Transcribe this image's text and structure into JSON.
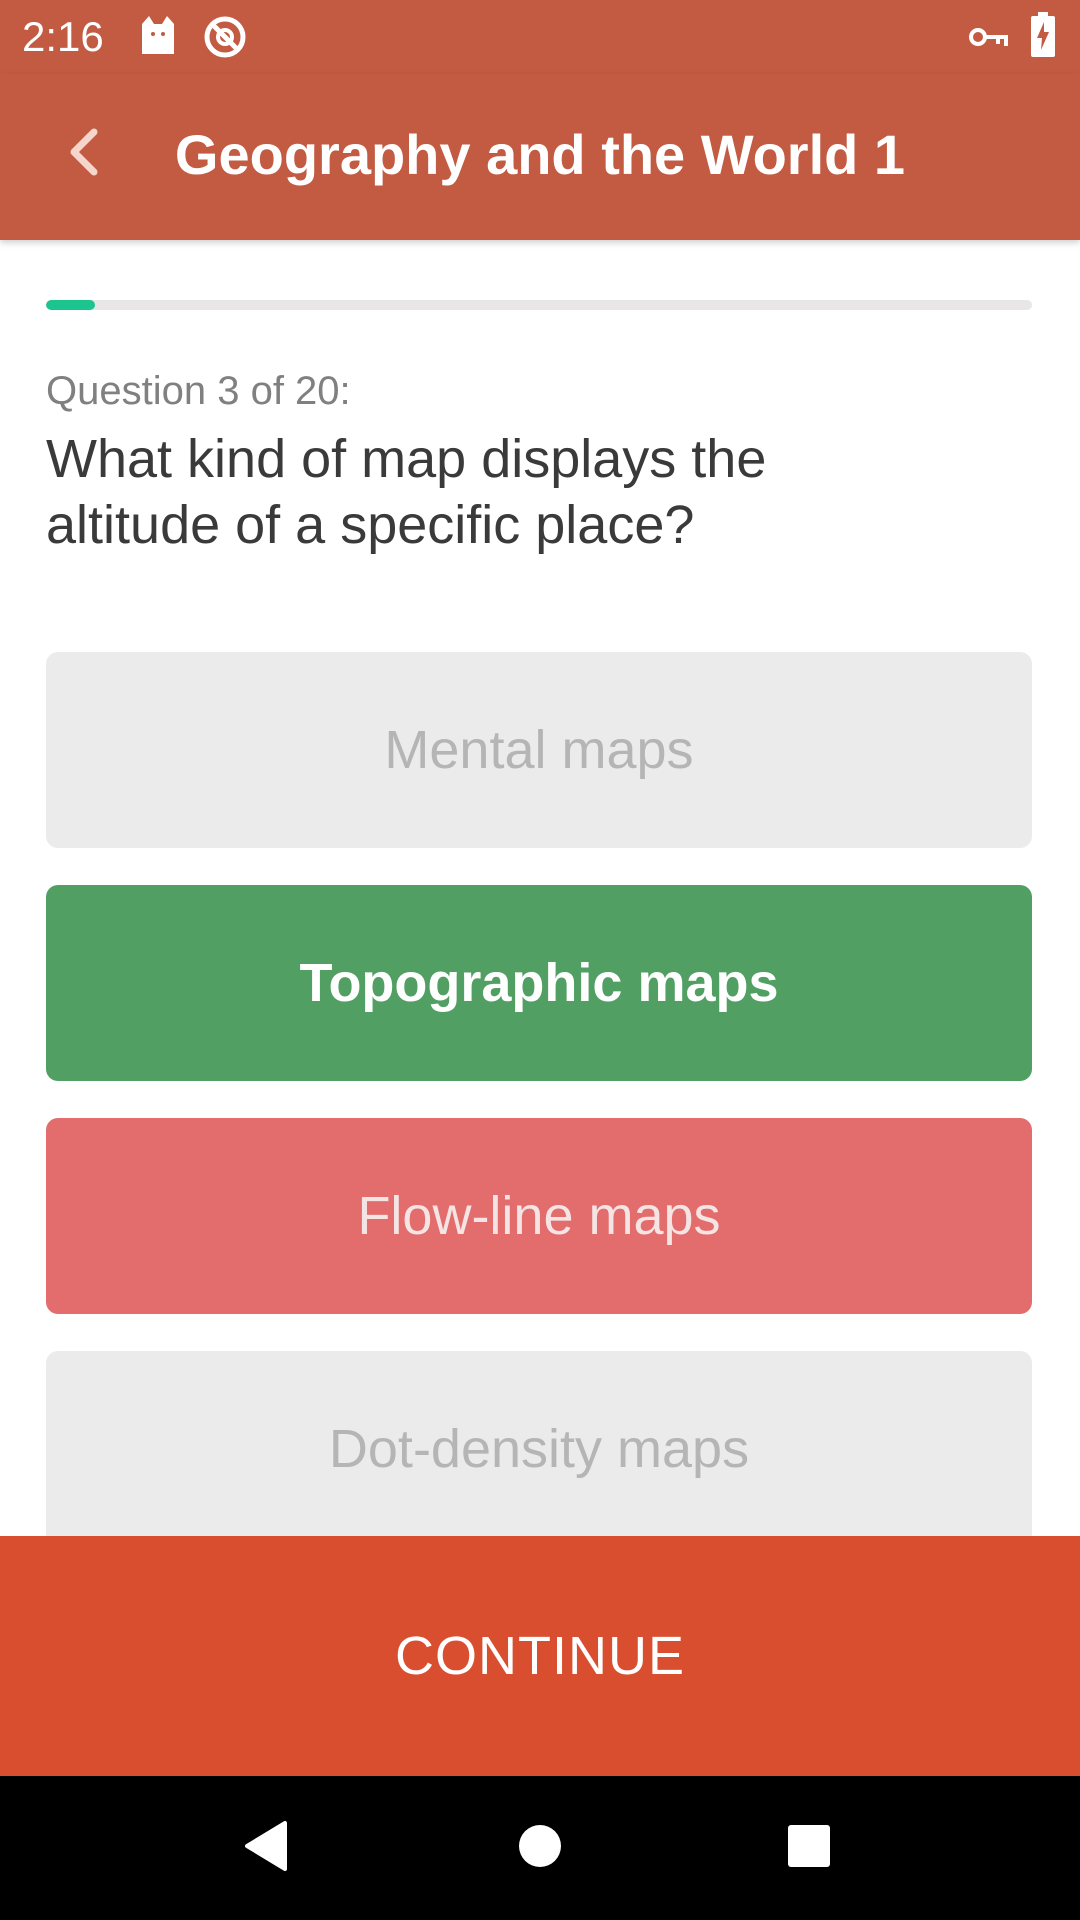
{
  "status_bar": {
    "time": "2:16",
    "left_icons": [
      "cat-notification-icon",
      "do-not-disturb-icon"
    ],
    "right_icons": [
      "vpn-key-icon",
      "battery-charging-icon"
    ]
  },
  "app_bar": {
    "title": "Geography and the World 1",
    "back_icon": "chevron-left-icon"
  },
  "progress": {
    "fraction": 0.05
  },
  "question": {
    "counter": "Question 3 of 20:",
    "text": "What kind of map displays the altitude of a specific place?"
  },
  "answers": [
    {
      "label": "Mental maps",
      "state": "neutral"
    },
    {
      "label": "Topographic maps",
      "state": "correct"
    },
    {
      "label": "Flow-line maps",
      "state": "wrong"
    },
    {
      "label": "Dot-density maps",
      "state": "neutral"
    }
  ],
  "continue_label": "CONTINUE",
  "nav_bar": {
    "icons": [
      "back-triangle-icon",
      "home-circle-icon",
      "recents-square-icon"
    ]
  },
  "colors": {
    "primary": "#C25B42",
    "continue": "#D94E2F",
    "correct": "#519F63",
    "wrong": "#E36C6C",
    "neutral": "#EBEBEB",
    "progress": "#1DC58E"
  }
}
